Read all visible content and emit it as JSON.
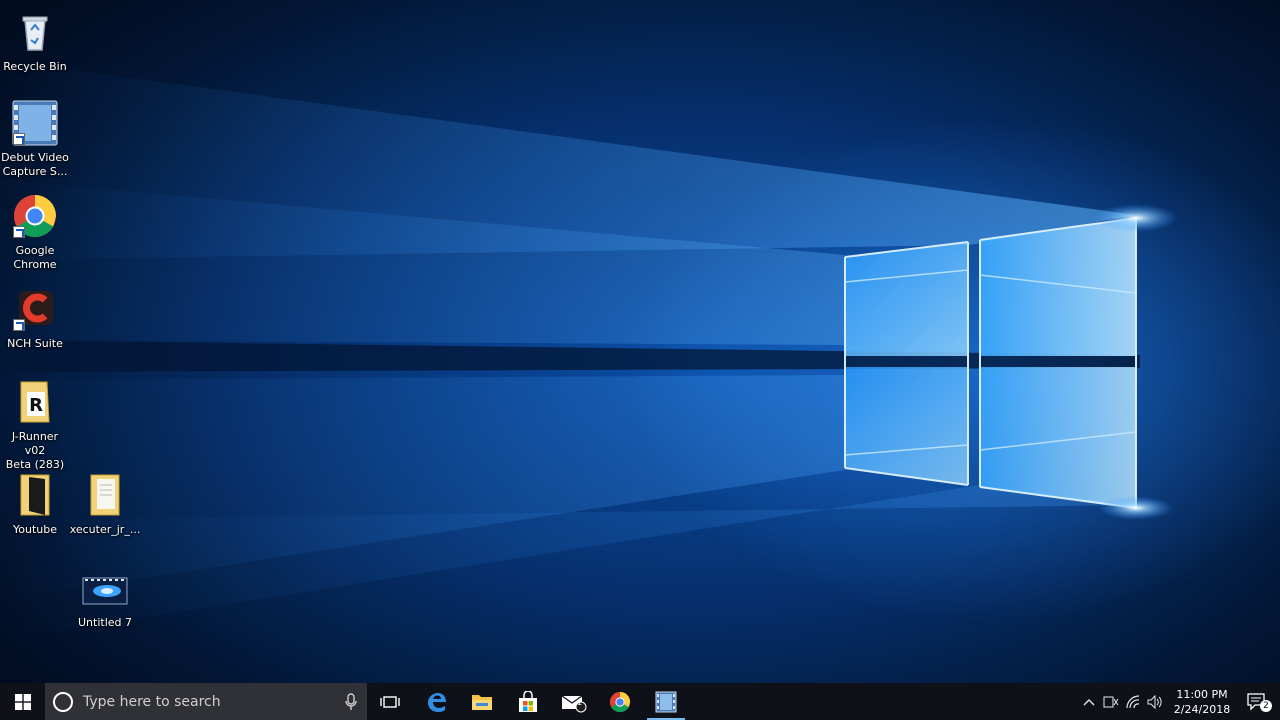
{
  "desktop": {
    "icons": [
      {
        "id": "recycle-bin",
        "label": "Recycle Bin"
      },
      {
        "id": "debut-video",
        "label": "Debut Video\nCapture S..."
      },
      {
        "id": "google-chrome",
        "label": "Google\nChrome"
      },
      {
        "id": "nch-suite",
        "label": "NCH Suite"
      },
      {
        "id": "j-runner",
        "label": "J-Runner v02\nBeta (283) ..."
      },
      {
        "id": "youtube",
        "label": "Youtube"
      },
      {
        "id": "xecuter",
        "label": "xecuter_jr_..."
      },
      {
        "id": "untitled-7",
        "label": "Untitled 7"
      }
    ]
  },
  "taskbar": {
    "search_placeholder": "Type here to search",
    "apps": [
      "task-view-icon",
      "edge-icon",
      "file-explorer-icon",
      "store-icon",
      "mail-icon",
      "chrome-icon",
      "debut-icon"
    ],
    "mail_badge": "1",
    "tray": {
      "time": "11:00 PM",
      "date": "2/24/2018",
      "notification_count": "2"
    }
  },
  "colors": {
    "taskbar": "#0e1117",
    "search_box": "#2f3136",
    "accent": "#76b9ed",
    "wallpaper_glow": "#4fb3ff"
  }
}
